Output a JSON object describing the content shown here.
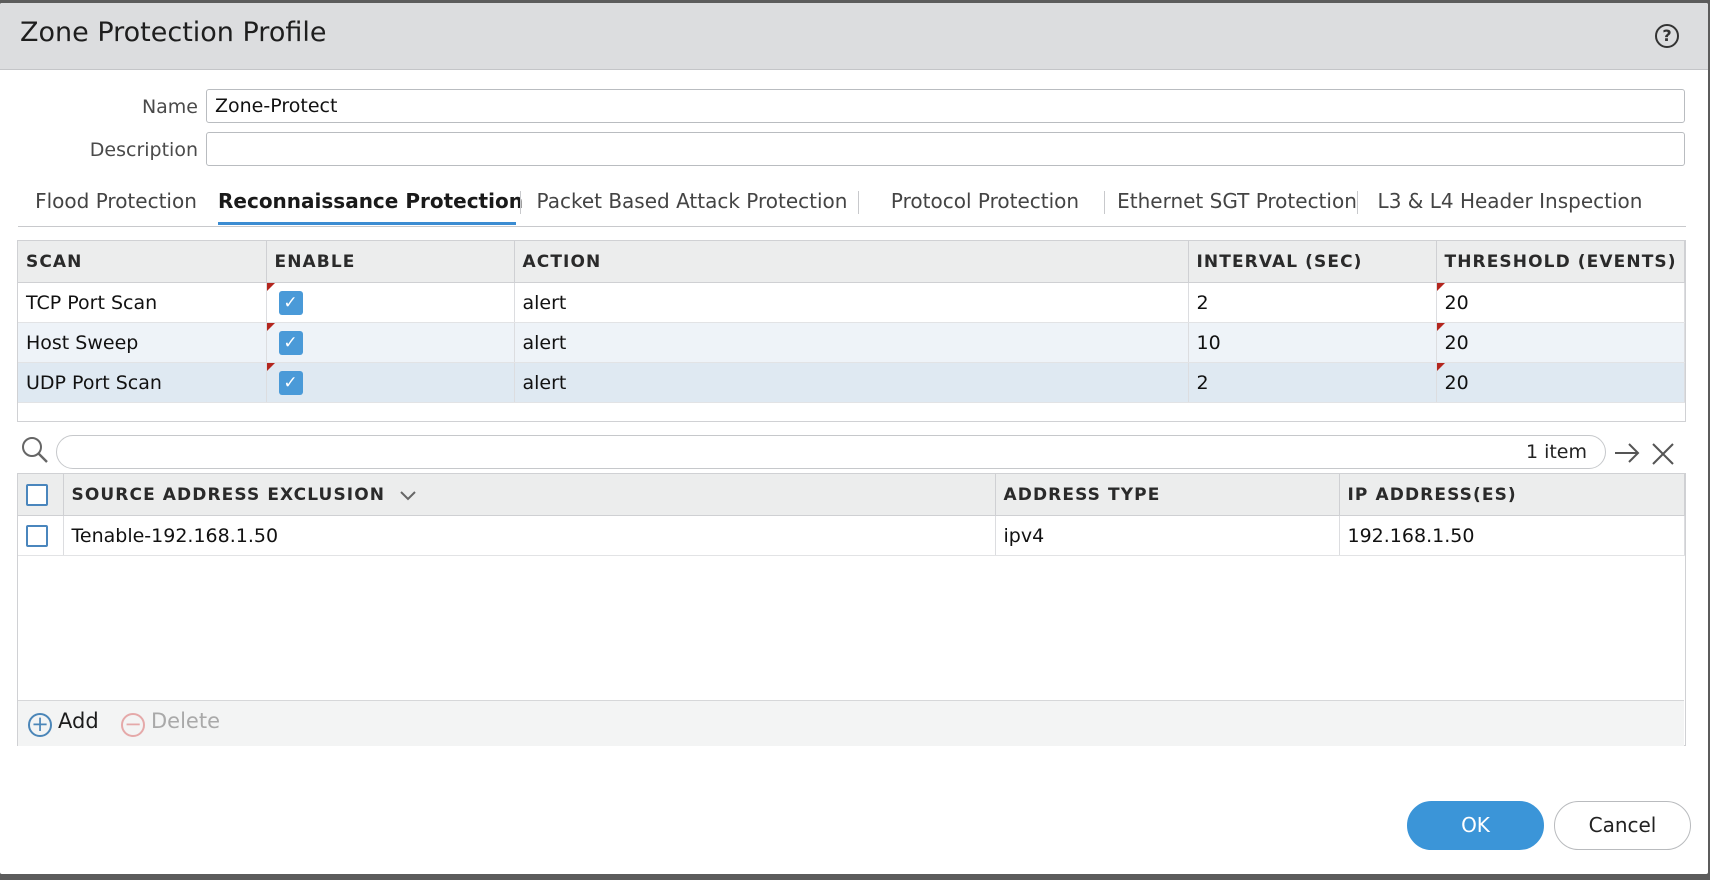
{
  "dialog": {
    "title": "Zone Protection Profile",
    "help_icon": "?"
  },
  "form": {
    "name_label": "Name",
    "name_value": "Zone-Protect",
    "description_label": "Description",
    "description_value": ""
  },
  "tabs": [
    {
      "label": "Flood Protection",
      "active": false
    },
    {
      "label": "Reconnaissance Protection",
      "active": true
    },
    {
      "label": "Packet Based Attack Protection",
      "active": false
    },
    {
      "label": "Protocol Protection",
      "active": false
    },
    {
      "label": "Ethernet SGT Protection",
      "active": false
    },
    {
      "label": "L3 & L4 Header Inspection",
      "active": false
    }
  ],
  "scan_table": {
    "headers": [
      "SCAN",
      "ENABLE",
      "ACTION",
      "INTERVAL (SEC)",
      "THRESHOLD (EVENTS)"
    ],
    "rows": [
      {
        "scan": "TCP Port Scan",
        "enabled": true,
        "action": "alert",
        "interval": "2",
        "threshold": "20"
      },
      {
        "scan": "Host Sweep",
        "enabled": true,
        "action": "alert",
        "interval": "10",
        "threshold": "20"
      },
      {
        "scan": "UDP Port Scan",
        "enabled": true,
        "action": "alert",
        "interval": "2",
        "threshold": "20"
      }
    ],
    "check_glyph": "✓"
  },
  "search": {
    "placeholder": "",
    "count": "1 item"
  },
  "exclusion_table": {
    "headers": [
      "SOURCE ADDRESS EXCLUSION",
      "ADDRESS TYPE",
      "IP ADDRESS(ES)"
    ],
    "rows": [
      {
        "name": "Tenable-192.168.1.50",
        "type": "ipv4",
        "ip": "192.168.1.50"
      }
    ]
  },
  "footer": {
    "add_label": "Add",
    "delete_label": "Delete",
    "add_icon": "+",
    "delete_icon": "−"
  },
  "buttons": {
    "ok": "OK",
    "cancel": "Cancel"
  },
  "colors": {
    "accent": "#3b95d8",
    "title_bar": "#dcdddf",
    "flag": "#b3261e"
  },
  "icons": [
    "help-icon",
    "search-icon",
    "arrow-right-icon",
    "close-icon",
    "add-circle-icon",
    "delete-circle-icon",
    "chevron-down-icon"
  ]
}
